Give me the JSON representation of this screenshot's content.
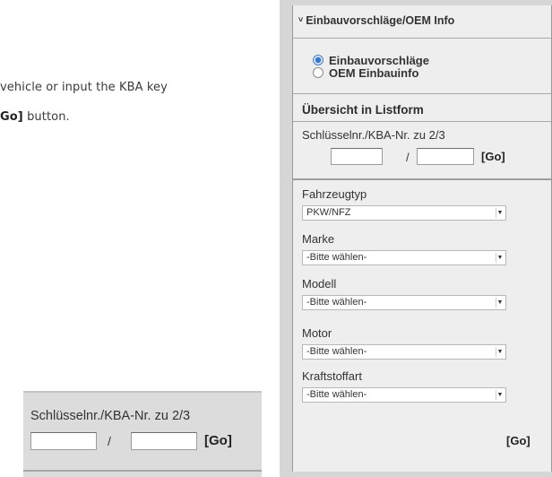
{
  "instructions": {
    "line1": "vehicle or input the KBA key",
    "line2_bold": "Go]",
    "line2_rest": " button."
  },
  "panel": {
    "header": {
      "chevron": "˅",
      "title": "Einbauvorschläge/OEM Info"
    },
    "radio_options": [
      {
        "label": "Einbauvorschläge",
        "selected": true
      },
      {
        "label": "OEM Einbauinfo",
        "selected": false
      }
    ],
    "listform_title": "Übersicht in Listform",
    "kba": {
      "label": "Schlüsselnr./KBA-Nr. zu 2/3",
      "separator": "/",
      "go_label": "[Go]"
    },
    "filters": [
      {
        "label": "Fahrzeugtyp",
        "value": "PKW/NFZ"
      },
      {
        "label": "Marke",
        "value": "-Bitte wählen-"
      },
      {
        "label": "Modell",
        "value": "-Bitte wählen-"
      },
      {
        "label": "Motor",
        "value": "-Bitte wählen-"
      },
      {
        "label": "Kraftstoffart",
        "value": "-Bitte wählen-"
      }
    ],
    "bottom_go": "[Go]"
  },
  "detail": {
    "label": "Schlüsselnr./KBA-Nr. zu 2/3",
    "separator": "/",
    "go_label": "[Go]"
  },
  "colors": {
    "panel_bg": "#eeeeee",
    "panel_frame": "#d6d6d6",
    "radio_selected": "#3b78c8"
  }
}
